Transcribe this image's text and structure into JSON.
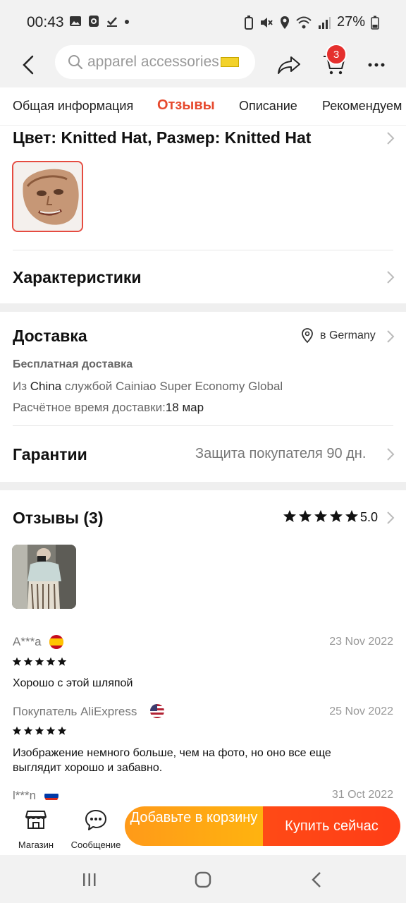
{
  "status_bar": {
    "time": "00:43",
    "battery": "27%"
  },
  "search": {
    "query": "apparel accessories"
  },
  "cart": {
    "count": "3"
  },
  "tabs": [
    {
      "label": "Общая информация"
    },
    {
      "label": "Отзывы"
    },
    {
      "label": "Описание"
    },
    {
      "label": "Рекомендуем"
    }
  ],
  "variant": {
    "title": "Цвет: Knitted Hat, Размер: Knitted Hat"
  },
  "specs": {
    "title": "Характеристики"
  },
  "delivery": {
    "title": "Доставка",
    "location": "в Germany",
    "free": "Бесплатная доставка",
    "from_prefix": "Из",
    "from_country": "China",
    "from_suffix": "службой Cainiao Super Economy Global",
    "eta_label": "Расчётное время доставки:",
    "eta_value": "18 мар"
  },
  "guarantee": {
    "title": "Гарантии",
    "value": "Защита покупателя 90 дн."
  },
  "reviews": {
    "title": "Отзывы (3)",
    "rating": "5.0",
    "rating_stars": 5,
    "items": [
      {
        "author": "A***a",
        "country": "es",
        "date": "23 Nov 2022",
        "stars": 5,
        "text": "Хорошо с этой шляпой"
      },
      {
        "author": "Покупатель AliExpress",
        "country": "us",
        "date": "25 Nov 2022",
        "stars": 5,
        "text": "Изображение немного больше, чем на фото, но оно все еще выглядит хорошо и забавно."
      },
      {
        "author": "l***n",
        "country": "ru",
        "date": "31 Oct 2022"
      }
    ]
  },
  "action_bar": {
    "store_label": "Магазин",
    "message_label": "Сообщение",
    "add_to_cart": "Добавьте в корзину",
    "buy_now": "Купить сейчас"
  },
  "colors": {
    "accent": "#e64a2e",
    "add_cart": "#ffa516",
    "buy_now": "#ff4416",
    "badge": "#e5302e"
  }
}
